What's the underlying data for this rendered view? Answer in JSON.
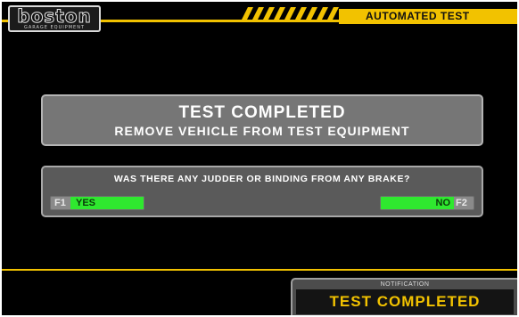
{
  "header": {
    "logo": {
      "word": "boston",
      "tagline": "GARAGE EQUIPMENT"
    },
    "title": "AUTOMATED TEST"
  },
  "main_panel": {
    "line1": "TEST COMPLETED",
    "line2": "REMOVE VEHICLE FROM TEST EQUIPMENT"
  },
  "question_panel": {
    "question": "WAS THERE ANY JUDDER OR BINDING FROM ANY BRAKE?",
    "yes": {
      "key": "F1",
      "label": "YES"
    },
    "no": {
      "key": "F2",
      "label": "NO"
    }
  },
  "notification": {
    "label": "NOTIFICATION",
    "message": "TEST COMPLETED"
  },
  "colors": {
    "accent": "#f2c200",
    "button_fill": "#2fe82f",
    "background": "#000000"
  }
}
